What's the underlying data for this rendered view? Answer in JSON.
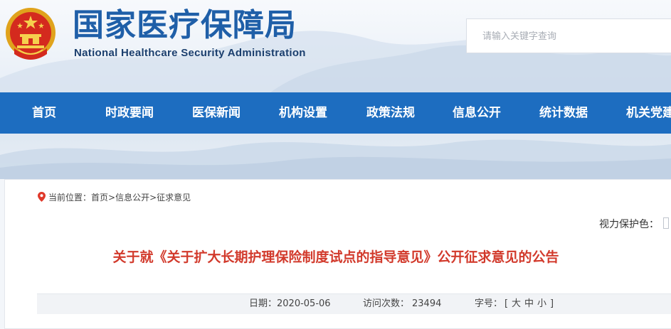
{
  "header": {
    "title_cn": "国家医疗保障局",
    "title_en": "National Healthcare Security Administration",
    "emblem_icon": "national-emblem-icon"
  },
  "search": {
    "placeholder": "请输入关键字查询",
    "value": ""
  },
  "nav": {
    "items": [
      {
        "label": "首页"
      },
      {
        "label": "时政要闻"
      },
      {
        "label": "医保新闻"
      },
      {
        "label": "机构设置"
      },
      {
        "label": "政策法规"
      },
      {
        "label": "信息公开"
      },
      {
        "label": "统计数据"
      },
      {
        "label": "机关党建"
      }
    ]
  },
  "breadcrumb": {
    "prefix": "当前位置：",
    "items": [
      "首页",
      "信息公开",
      "征求意见"
    ],
    "separator": ">"
  },
  "vision": {
    "label": "视力保护色："
  },
  "article": {
    "title": "关于就《关于扩大长期护理保险制度试点的指导意见》公开征求意见的公告",
    "date_label": "日期：",
    "date": "2020-05-06",
    "views_label": "访问次数：",
    "views": "23494",
    "font_label": "字号：",
    "bracket_open": "[",
    "size_large": "大",
    "size_medium": "中",
    "size_small": "小",
    "bracket_close": "]"
  },
  "colors": {
    "nav_bg": "#1d6dc0",
    "brand_blue": "#1f5fa8",
    "title_red": "#d23a2c",
    "meta_bg": "#f1f3f6"
  }
}
